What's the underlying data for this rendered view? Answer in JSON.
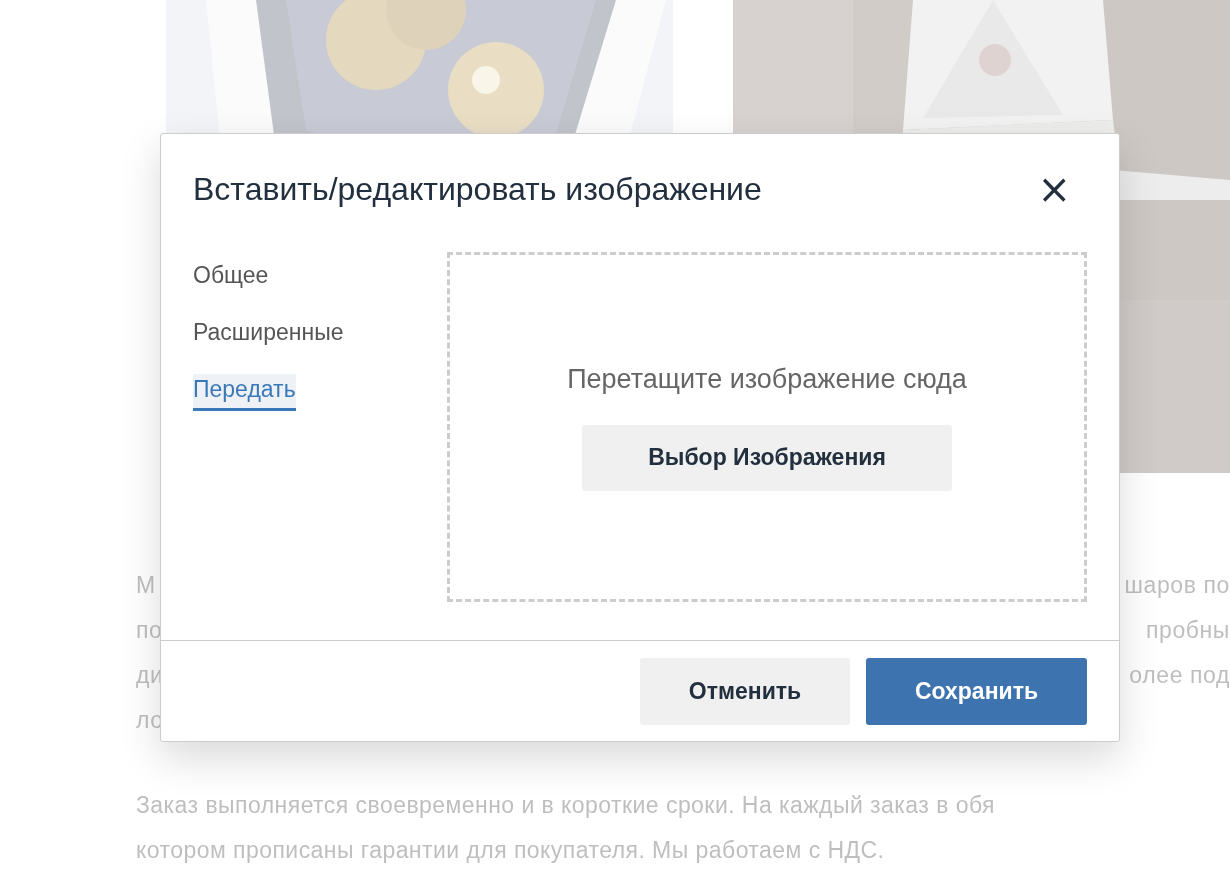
{
  "background": {
    "pictures": [
      {
        "kind": "picture"
      },
      {
        "kind": "picture"
      }
    ],
    "paragraph_1_fragments": [
      {
        "left": "М",
        "right": "шаров по"
      },
      {
        "left": "по",
        "right": "пробны"
      },
      {
        "left": "ди",
        "right": "олее под"
      },
      {
        "left": "ло"
      }
    ],
    "paragraph_2": [
      "Заказ выполняется своевременно и в короткие сроки. На каждый заказ в обя",
      "котором прописаны гарантии для покупателя. Мы работаем с НДС."
    ]
  },
  "dialog": {
    "title": "Вставить/редактировать изображение",
    "close": "×",
    "tabs": [
      {
        "label": "Общее",
        "selected": false
      },
      {
        "label": "Расширенные",
        "selected": false
      },
      {
        "label": "Передать",
        "selected": true
      }
    ],
    "dropzone": {
      "text": "Перетащите изображение сюда",
      "button": "Выбор Изображения"
    },
    "buttons": [
      {
        "label": "Отменить",
        "kind": "secondary"
      },
      {
        "label": "Сохранить",
        "kind": "primary"
      }
    ]
  }
}
